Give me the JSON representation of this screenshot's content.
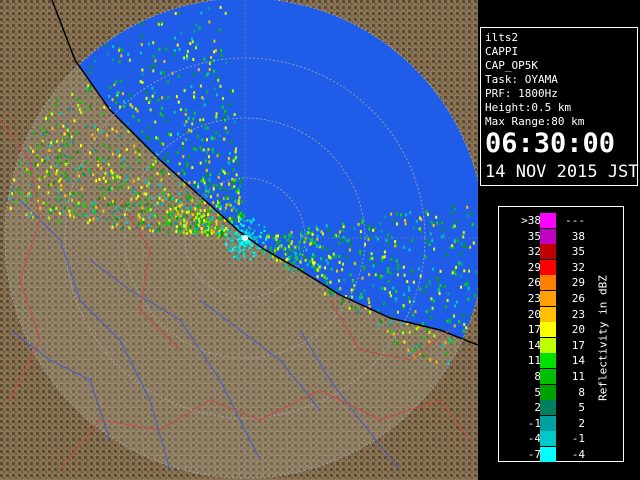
{
  "window": {
    "background": "#000000"
  },
  "radar": {
    "ocean_color": "#1f5ce8",
    "land_color": "#8a7556",
    "land_dark_color": "#5c4a32",
    "coast_color": "#000000",
    "river_color": "#4a5cc8",
    "boundary_color": "#c84a4a",
    "range_ring_color": "#aaaaaa",
    "radar_site_color": "#ffffff"
  },
  "info": {
    "lines": [
      "ilts2",
      "CAPPI",
      "CAP_OP5K",
      "Task: OYAMA",
      "PRF: 1800Hz",
      "Height:0.5 km",
      "Max Range:80 km"
    ],
    "time": "06:30:00",
    "date": "14 NOV 2015 JST"
  },
  "legend": {
    "title": "Reflectivity in dBZ",
    "rows": [
      {
        "low": ">38",
        "high": "---",
        "color": "#ff00ff"
      },
      {
        "low": "35",
        "high": "38",
        "color": "#c000c0"
      },
      {
        "low": "32",
        "high": "35",
        "color": "#c00000"
      },
      {
        "low": "29",
        "high": "32",
        "color": "#ff0000"
      },
      {
        "low": "26",
        "high": "29",
        "color": "#ff8000"
      },
      {
        "low": "23",
        "high": "26",
        "color": "#ffa000"
      },
      {
        "low": "20",
        "high": "23",
        "color": "#ffc000"
      },
      {
        "low": "17",
        "high": "20",
        "color": "#ffff00"
      },
      {
        "low": "14",
        "high": "17",
        "color": "#c0ff00"
      },
      {
        "low": "11",
        "high": "14",
        "color": "#00e000"
      },
      {
        "low": "8",
        "high": "11",
        "color": "#00c000"
      },
      {
        "low": "5",
        "high": "8",
        "color": "#00a000"
      },
      {
        "low": "2",
        "high": "5",
        "color": "#008060"
      },
      {
        "low": "-1",
        "high": "2",
        "color": "#00a0a0"
      },
      {
        "low": "-4",
        "high": "-1",
        "color": "#00c8c8"
      },
      {
        "low": "-7",
        "high": "-4",
        "color": "#00ffff"
      }
    ]
  }
}
